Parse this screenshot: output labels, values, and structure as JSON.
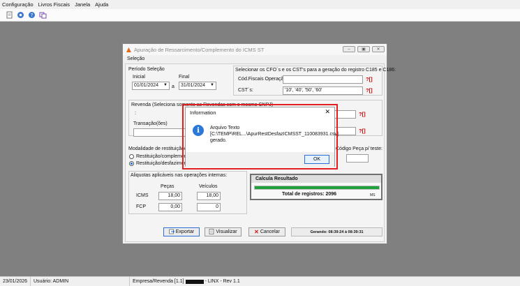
{
  "menu": [
    "Configuração",
    "Livros Fiscais",
    "Janela",
    "Ajuda"
  ],
  "toolbar_icons": [
    "document-icon",
    "gear-icon",
    "help-icon",
    "window-icon"
  ],
  "window": {
    "title": "Apuração de Ressarcimento/Complemento do ICMS ST",
    "tab": "Seleção",
    "periodo": {
      "label": "Período Seleção",
      "inicial_label": "Inicial",
      "inicial": "01/01/2024",
      "a": "a",
      "final_label": "Final",
      "final": "31/01/2024"
    },
    "cfo": {
      "label": "Selecionar os CFO´s e os CST's para a geração do registro C185 e C186:",
      "cod_label": "Cód.Fiscais Operação:",
      "cod_value": "",
      "cst_label": "CST´s:",
      "cst_value": "'10', '40', '50', '60'"
    },
    "revenda": {
      "label": "Revenda (Seleciona somente as Revendas com o mesmo CNPJ)",
      "colon": ":",
      "transacao_label": "Transação(ões)"
    },
    "modalidade": {
      "label": "Modalidade de restituição/com",
      "opt1": "Restituição/complemento n",
      "opt2": "Restituição/desfazimento n"
    },
    "codigo_label": "Código Peça p/ teste:",
    "aliquotas": {
      "label": "Aliquotas aplicáveis nas operações internas:",
      "pecas": "Peças",
      "veiculos": "Veículos",
      "icms": "ICMS",
      "fcp": "FCP",
      "icms_pecas": "18,00",
      "icms_veic": "18,00",
      "fcp_pecas": "0,00",
      "fcp_veic": "0"
    },
    "calc": {
      "title": "Calcula Resultado",
      "total": "Total de registros: 2096",
      "unit": "MS",
      "progress": 1.0
    },
    "buttons": {
      "exportar": "Exportar",
      "visualizar": "Visualizar",
      "cancelar": "Cancelar"
    },
    "gerando": "Gerando: 08:39:24 à 08:39:31"
  },
  "dialog": {
    "title": "Information",
    "line1": "Arquivo Texto",
    "line2": "[C:\\TEMP\\REL...\\ApurRestDesfazICMSST_110083931.csv]",
    "line3": "gerado.",
    "ok": "OK"
  },
  "status": {
    "date": "23/01/2026",
    "user": "Usuário: ADMIN",
    "empresa": "Empresa/Revenda [1.1]",
    "version": "- LINX - Rev 1.1"
  }
}
